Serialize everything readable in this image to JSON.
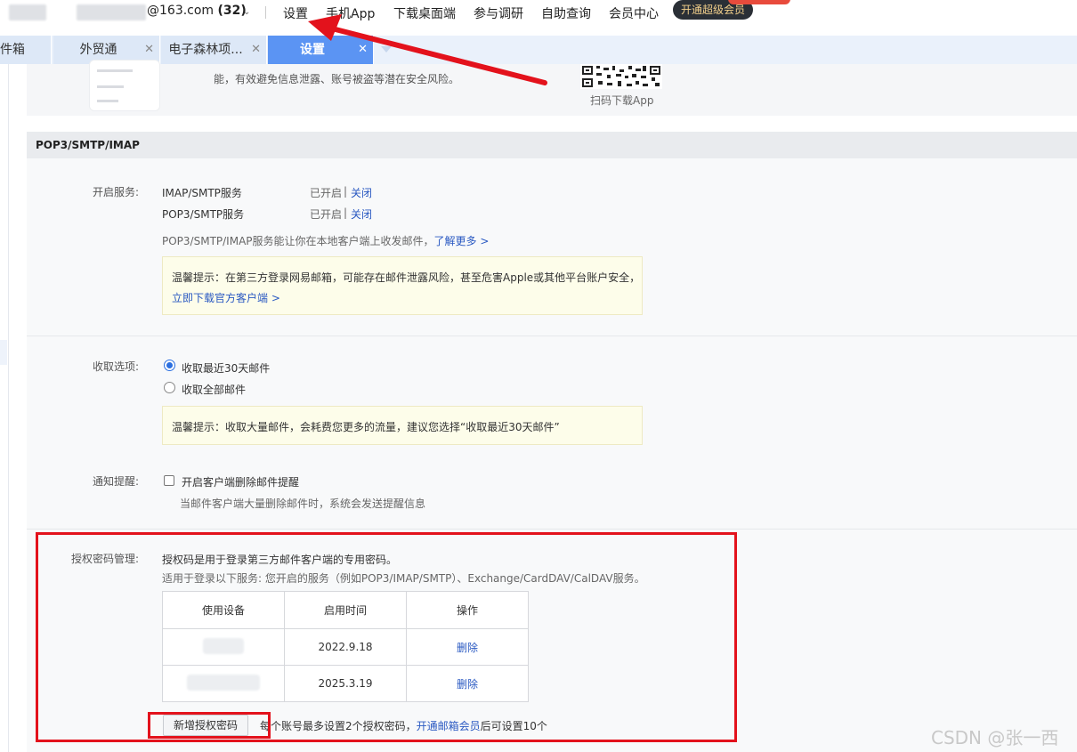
{
  "topbar": {
    "account_suffix": "@163.com",
    "unread_count": "(32)",
    "nav": [
      "设置",
      "手机App",
      "下载桌面端",
      "参与调研",
      "自助查询",
      "会员中心"
    ],
    "vip_button": "开通超级会员"
  },
  "tabs": [
    {
      "label": "件箱",
      "closable": false
    },
    {
      "label": "外贸通",
      "closable": true
    },
    {
      "label": "电子森林项...",
      "closable": true
    },
    {
      "label": "设置",
      "closable": true,
      "active": true
    }
  ],
  "banner": {
    "text": "能，有效避免信息泄露、账号被盗等潜在安全风险。",
    "qr_caption": "扫码下载App"
  },
  "section": {
    "title": "POP3/SMTP/IMAP",
    "services": {
      "label": "开启服务:",
      "items": [
        {
          "name": "IMAP/SMTP服务",
          "status": "已开启",
          "sep": "|",
          "action": "关闭"
        },
        {
          "name": "POP3/SMTP服务",
          "status": "已开启",
          "sep": "|",
          "action": "关闭"
        }
      ],
      "desc": "POP3/SMTP/IMAP服务能让你在本地客户端上收发邮件，",
      "learn_more": "了解更多 >",
      "tip_line1": "温馨提示：在第三方登录网易邮箱，可能存在邮件泄露风险，甚至危害Apple或其他平台账户安全，",
      "tip_link": "立即下载官方客户端 >"
    },
    "receive": {
      "label": "收取选项:",
      "options": [
        {
          "label": "收取最近30天邮件",
          "selected": true
        },
        {
          "label": "收取全部邮件",
          "selected": false
        }
      ],
      "tip": "温馨提示：收取大量邮件，会耗费您更多的流量，建议您选择“收取最近30天邮件”"
    },
    "notify": {
      "label": "通知提醒:",
      "checkbox_label": "开启客户端删除邮件提醒",
      "checked": false,
      "desc": "当邮件客户端大量删除邮件时，系统会发送提醒信息"
    },
    "auth": {
      "label": "授权密码管理:",
      "desc1": "授权码是用于登录第三方邮件客户端的专用密码。",
      "desc2": "适用于登录以下服务: 您开启的服务（例如POP3/IMAP/SMTP）、Exchange/CardDAV/CalDAV服务。",
      "table": {
        "headers": [
          "使用设备",
          "启用时间",
          "操作"
        ],
        "rows": [
          {
            "device": "",
            "time": "2022.9.18",
            "action": "删除"
          },
          {
            "device": "",
            "time": "2025.3.19",
            "action": "删除"
          }
        ]
      },
      "add_button": "新增授权密码",
      "limit_prefix": "每个账号最多设置2个授权密码，",
      "limit_link": "开通邮箱会员",
      "limit_suffix": "后可设置10个"
    }
  },
  "watermark": "CSDN @张一西",
  "colors": {
    "accent": "#5b94f3",
    "link": "#2a59c2",
    "annotation": "#e3121c",
    "tip_bg": "#fdfdea"
  }
}
